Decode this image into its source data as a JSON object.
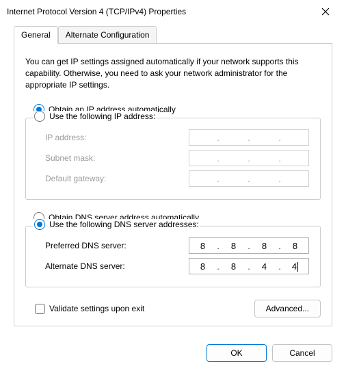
{
  "titlebar": {
    "title": "Internet Protocol Version 4 (TCP/IPv4) Properties"
  },
  "tabs": {
    "general": "General",
    "alternate": "Alternate Configuration"
  },
  "description": "You can get IP settings assigned automatically if your network supports this capability. Otherwise, you need to ask your network administrator for the appropriate IP settings.",
  "ip": {
    "auto_label": "Obtain an IP address automatically",
    "manual_label": "Use the following IP address:",
    "address_label": "IP address:",
    "subnet_label": "Subnet mask:",
    "gateway_label": "Default gateway:",
    "address": [
      "",
      "",
      "",
      ""
    ],
    "subnet": [
      "",
      "",
      "",
      ""
    ],
    "gateway": [
      "",
      "",
      "",
      ""
    ]
  },
  "dns": {
    "auto_label": "Obtain DNS server address automatically",
    "manual_label": "Use the following DNS server addresses:",
    "preferred_label": "Preferred DNS server:",
    "alternate_label": "Alternate DNS server:",
    "preferred": [
      "8",
      "8",
      "8",
      "8"
    ],
    "alternate": [
      "8",
      "8",
      "4",
      "4"
    ]
  },
  "validate_label": "Validate settings upon exit",
  "buttons": {
    "advanced": "Advanced...",
    "ok": "OK",
    "cancel": "Cancel"
  }
}
